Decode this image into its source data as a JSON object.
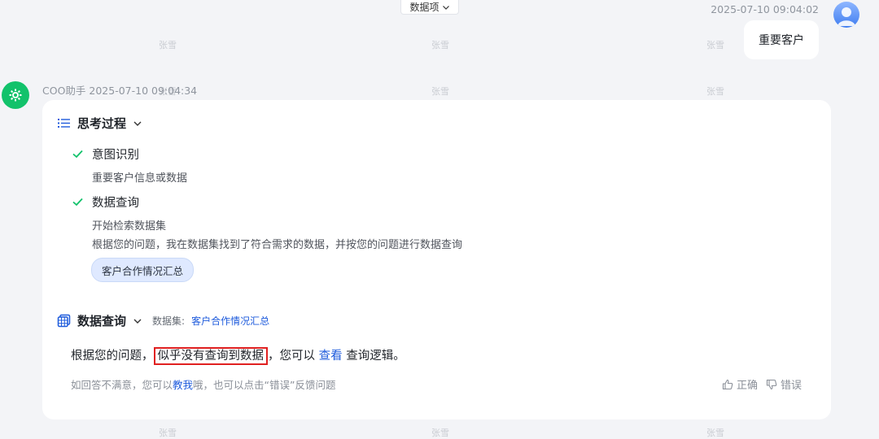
{
  "top_dropdown": {
    "label": "数据项"
  },
  "user_message": {
    "timestamp": "2025-07-10 09:04:02",
    "text": "重要客户"
  },
  "bot": {
    "name_time": "COO助手 2025-07-10 09:04:34"
  },
  "thinking": {
    "title": "思考过程",
    "steps": [
      {
        "label": "意图识别",
        "details": [
          "重要客户信息或数据"
        ]
      },
      {
        "label": "数据查询",
        "details": [
          "开始检索数据集",
          "根据您的问题，我在数据集找到了符合需求的数据，并按您的问题进行数据查询"
        ]
      }
    ],
    "dataset_tag": "客户合作情况汇总"
  },
  "data_query": {
    "title": "数据查询",
    "dataset_label": "数据集:",
    "dataset_name": "客户合作情况汇总",
    "answer": {
      "prefix": "根据您的问题，",
      "highlight": "似乎没有查询到数据",
      "middle": "，您可以",
      "link": "查看",
      "suffix": "查询逻辑。"
    }
  },
  "feedback": {
    "hint_prefix": "如回答不满意，您可以",
    "hint_link": "教我",
    "hint_suffix": "哦，也可以点击“错误”反馈问题",
    "correct_label": "正确",
    "wrong_label": "错误"
  },
  "watermark": "张雪",
  "colors": {
    "accent": "#1e5bdc",
    "check": "#12c26b",
    "highlight_border": "#e02020",
    "bot_avatar": "#12c26b"
  }
}
